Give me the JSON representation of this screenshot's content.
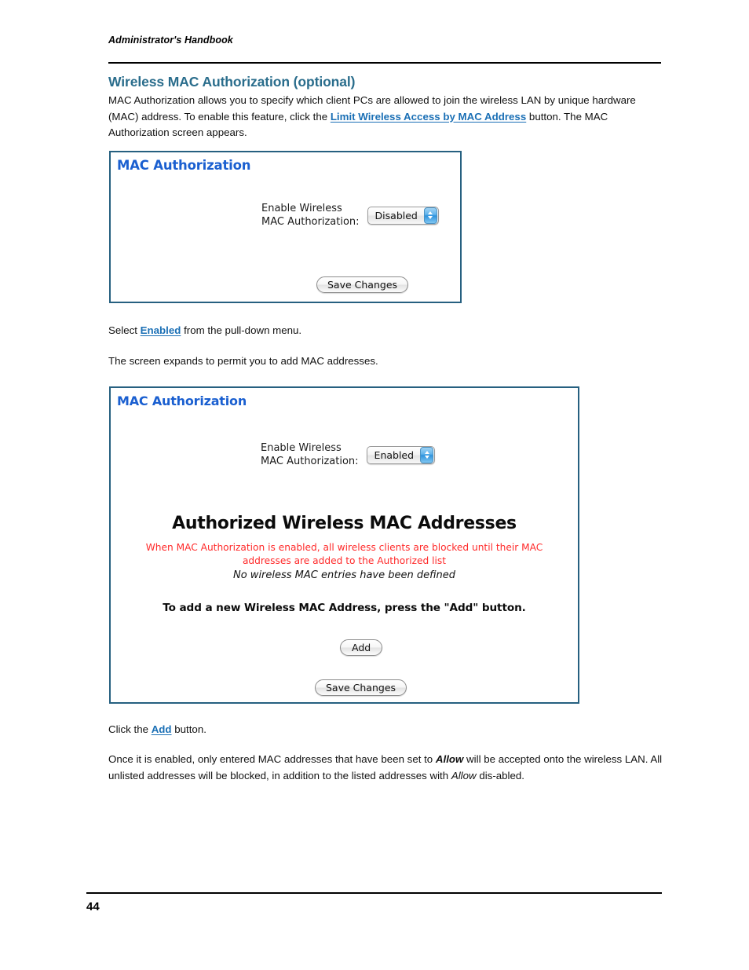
{
  "document": {
    "running_head": "Administrator's Handbook",
    "page_number": "44",
    "section_heading": "Wireless MAC Authorization (optional)"
  },
  "colors": {
    "heading": "#2a6d8c",
    "link": "#1a6fb5",
    "panel_border": "#266080",
    "panel_title": "#1a5fd0",
    "warning_red": "#ff2a2a"
  },
  "paragraphs": {
    "intro": {
      "part1": "MAC Authorization allows you to specify which client PCs are allowed to join the wireless LAN by unique hardware (MAC) address. To enable this feature, click the ",
      "link": "Limit Wireless Access by MAC Address",
      "part2": " button. The MAC Authorization screen appears."
    },
    "select_enabled": {
      "part1": "Select ",
      "link": "Enabled",
      "part2": " from the pull-down menu."
    },
    "screen_expands": "The screen expands to permit you to add MAC addresses.",
    "click_add": {
      "part1": "Click the ",
      "link": "Add",
      "part2": " button."
    },
    "once_enabled": {
      "part1": "Once it is enabled, only entered MAC addresses that have been set to ",
      "emph1": "Allow",
      "part2": " will be accepted onto the wireless LAN. All unlisted addresses will be blocked, in addition to the listed addresses with ",
      "emph2": "Allow",
      "part3": " dis-abled."
    }
  },
  "screenshot_disabled": {
    "title": "MAC Authorization",
    "field_label": "Enable Wireless\nMAC Authorization:",
    "dropdown_value": "Disabled",
    "dropdown_options": [
      "Disabled",
      "Enabled"
    ],
    "save_button": "Save Changes"
  },
  "screenshot_enabled": {
    "title": "MAC Authorization",
    "field_label": "Enable Wireless\nMAC Authorization:",
    "dropdown_value": "Enabled",
    "dropdown_options": [
      "Disabled",
      "Enabled"
    ],
    "auth_heading": "Authorized Wireless MAC Addresses",
    "warning_text": "When MAC Authorization is enabled, all wireless clients are blocked until their MAC addresses are added to the Authorized list",
    "none_defined": "No wireless MAC entries have been defined",
    "add_instruction": "To add a new Wireless MAC Address, press the \"Add\" button.",
    "add_button": "Add",
    "save_button": "Save Changes"
  }
}
